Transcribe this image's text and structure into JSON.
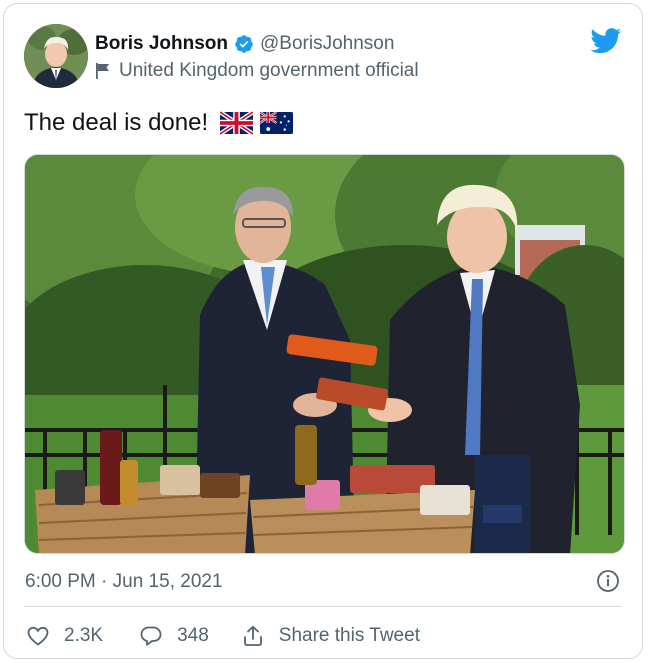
{
  "author": {
    "display_name": "Boris Johnson",
    "handle": "@BorisJohnson",
    "affiliation_label": "United Kingdom government official"
  },
  "tweet": {
    "text": "The deal is done!",
    "emojis": [
      "uk-flag-emoji",
      "australia-flag-emoji"
    ]
  },
  "meta": {
    "timestamp": "6:00 PM · Jun 15, 2021"
  },
  "actions": {
    "like_count": "2.3K",
    "reply_count": "348",
    "share_label": "Share this Tweet"
  },
  "colors": {
    "twitter_blue": "#1d9bf0",
    "secondary_text": "#536471",
    "border": "#cfd9de"
  }
}
